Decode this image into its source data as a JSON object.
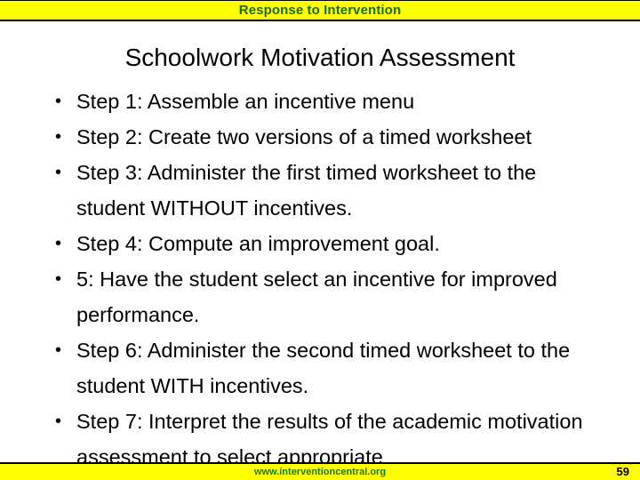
{
  "header": {
    "title": "Response to Intervention",
    "background_color": "#ffff00",
    "text_color": "#1a6b16"
  },
  "slide": {
    "title": "Schoolwork Motivation Assessment",
    "title_color": "#000000",
    "background_color": "#ffffff"
  },
  "body": {
    "bullet_marker": "•",
    "items": [
      {
        "text": "Step 1: Assemble an incentive menu"
      },
      {
        "text": "Step 2: Create two versions of a timed worksheet"
      },
      {
        "text": "Step 3: Administer the first timed worksheet to the student WITHOUT incentives."
      },
      {
        "text": "Step 4: Compute an improvement goal."
      },
      {
        "text": "5: Have the student select an incentive for improved performance."
      },
      {
        "text": "Step 6: Administer the second timed worksheet to the student WITH incentives."
      },
      {
        "text": "Step 7: Interpret the results of the academic motivation assessment to select appropriate"
      }
    ]
  },
  "footer": {
    "url": "www.interventioncentral.org",
    "url_color": "#1a7a16",
    "page_number": "59",
    "background_color": "#ffff00"
  }
}
